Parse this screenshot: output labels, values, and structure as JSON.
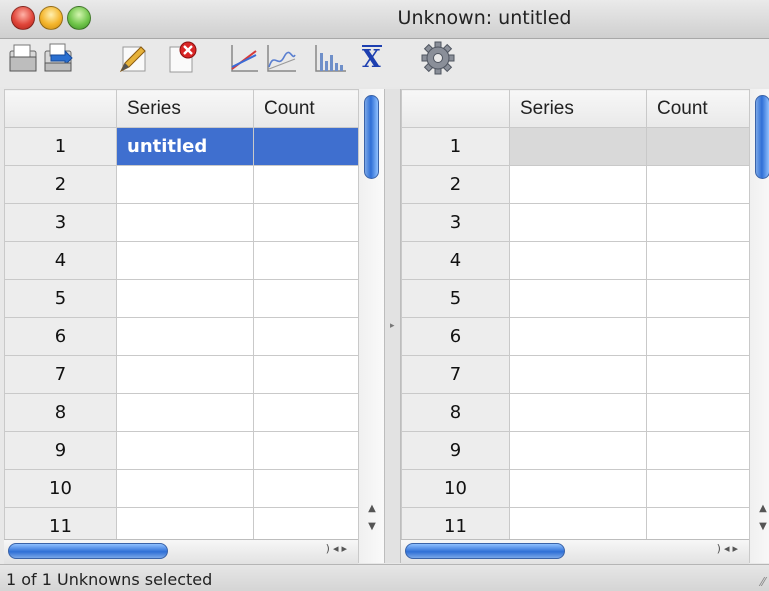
{
  "window": {
    "title": "Unknown: untitled"
  },
  "toolbar": {
    "icons": [
      "open-document-icon",
      "import-icon",
      "edit-icon",
      "delete-icon",
      "line-chart-icon",
      "curve-chart-icon",
      "bar-chart-icon",
      "mean-x-bar-icon",
      "settings-gear-icon"
    ],
    "mean_symbol": "X"
  },
  "left_table": {
    "columns": [
      "",
      "Series",
      "Count"
    ],
    "rows": [
      {
        "num": "1",
        "series": "untitled",
        "count": ""
      },
      {
        "num": "2",
        "series": "",
        "count": ""
      },
      {
        "num": "3",
        "series": "",
        "count": ""
      },
      {
        "num": "4",
        "series": "",
        "count": ""
      },
      {
        "num": "5",
        "series": "",
        "count": ""
      },
      {
        "num": "6",
        "series": "",
        "count": ""
      },
      {
        "num": "7",
        "series": "",
        "count": ""
      },
      {
        "num": "8",
        "series": "",
        "count": ""
      },
      {
        "num": "9",
        "series": "",
        "count": ""
      },
      {
        "num": "10",
        "series": "",
        "count": ""
      },
      {
        "num": "11",
        "series": "",
        "count": ""
      }
    ],
    "selected_row": "1"
  },
  "right_table": {
    "columns": [
      "",
      "Series",
      "Count"
    ],
    "rows": [
      {
        "num": "1",
        "series": "",
        "count": ""
      },
      {
        "num": "2",
        "series": "",
        "count": ""
      },
      {
        "num": "3",
        "series": "",
        "count": ""
      },
      {
        "num": "4",
        "series": "",
        "count": ""
      },
      {
        "num": "5",
        "series": "",
        "count": ""
      },
      {
        "num": "6",
        "series": "",
        "count": ""
      },
      {
        "num": "7",
        "series": "",
        "count": ""
      },
      {
        "num": "8",
        "series": "",
        "count": ""
      },
      {
        "num": "9",
        "series": "",
        "count": ""
      },
      {
        "num": "10",
        "series": "",
        "count": ""
      },
      {
        "num": "11",
        "series": "",
        "count": ""
      }
    ]
  },
  "status": {
    "text": "1 of 1 Unknowns selected"
  },
  "colors": {
    "selection": "#3f6fcf",
    "scroll_thumb": "#2f6fd6"
  }
}
